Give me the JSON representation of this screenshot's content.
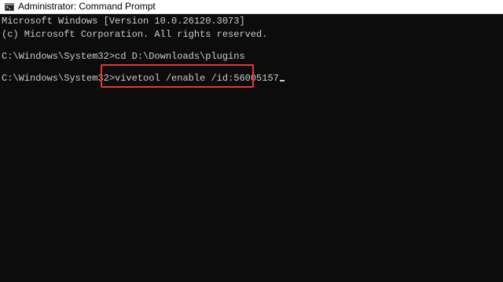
{
  "window": {
    "title": "Administrator: Command Prompt",
    "icon": "command-prompt-icon"
  },
  "console": {
    "lines": [
      "Microsoft Windows [Version 10.0.26120.3073]",
      "(c) Microsoft Corporation. All rights reserved.",
      "C:\\Windows\\System32>cd D:\\Downloads\\plugins"
    ],
    "prompt": "C:\\Windows\\System32>",
    "current_command": "vivetool /enable /id:56005157"
  },
  "colors": {
    "console_background": "#0c0c0c",
    "console_text": "#cccccc",
    "highlight": "#e23a2e"
  }
}
